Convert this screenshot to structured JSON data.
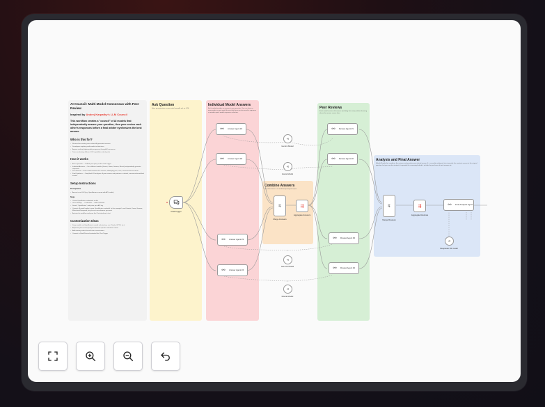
{
  "intro": {
    "title": "AI Council: Multi-Model Consensus with Peer Review",
    "inspired_prefix": "Inspired by ",
    "inspired_link": "Andrej Karpathy's LLM Council",
    "lead": "This workflow creates a \"council\" of AI models that independently answer your question, then peer-review each other's responses before a final arbiter synthesizes the best answer.",
    "who_heading": "Who is this for?",
    "who_items": [
      "Researchers wanting more robust AI-generated answers",
      "Developers exploring multi-model architectures",
      "Anyone seeking higher-quality responses through AI consensus",
      "Teams evaluating different LLM capabilities side-by-side"
    ],
    "how_heading": "How it works",
    "how_items": [
      "Ask a Question — Submit your query via the Chat Trigger",
      "Individual Answers — Four different models (Gemini, Llama, Gemma, Mistral) independently generate responses",
      "Peer Review — Each model reviews all 4 answers, identifying pros, cons, and overall assessment",
      "Final Synthesis — DeepSeek R1 analyzes all peer reviews and produces a refined, consensus-based final answer"
    ],
    "setup_heading": "Setup Instructions",
    "prereq_label": "Prerequisites",
    "prereq_items": [
      "Access to an LLM (e.g. OpenRouter account with API credits)"
    ],
    "steps_label": "Steps",
    "steps_items": [
      "Create OpenRouter credentials in n8n",
      "Go to Settings → Credentials → Add Credential",
      "Search \"OpenRouter\" and paste your API key",
      "Connect all model nodes to your OpenRouter credential. In this example I used Gemini, Llama, Gemma, Mistral and Deepseek, but you can use whatever you want.",
      "Activate the workflow and open the Chat interface to test"
    ],
    "custom_heading": "Customization Ideas",
    "custom_items": [
      "Swap models via OpenRouter's model selector (e.g. use Claude, GPT-4, etc.)",
      "Adjust the peer review prompt for domain-specific evaluation criteria",
      "Add memory nodes for multi-turn conversations",
      "Connect to Slack/Discord instead of the Chat Trigger"
    ]
  },
  "sections": {
    "ask": {
      "title": "Ask Question",
      "desc": "Enter your question as you would normally ask an LLM."
    },
    "individual": {
      "title": "Individual Model Answers",
      "desc": "Each model provides an answer to your question. You can have as many nodes as you want. As note that these are also used in sequence so avoid to quick model responses selection."
    },
    "combine": {
      "title": "Combine Answers",
      "desc": "Get all answers in a combined (anonymous) list."
    },
    "peer": {
      "title": "Peer Reviews",
      "desc": "Each model reviews all answers (including their own), without knowing where the answer comes from."
    },
    "analysis": {
      "title": "Analysis and Final Answer",
      "desc": "A final AI node that combines the reviews and provides your refined answer. It is currently configured to just provide the smartest answer to the original question, but you can also instruct it to provide the reasoning behind it, include the pros/cons of each answer etc."
    }
  },
  "nodes": {
    "chat_trigger": "Chat Trigger",
    "answer_agents": [
      "Answer Agent #1",
      "Answer Agent #2",
      "Answer Agent #3",
      "Answer Agent #4"
    ],
    "models_left": [
      "Gemini Model",
      "Llama Model",
      "Gemma Model",
      "Mistral Model"
    ],
    "merge_answers": "Merge Answers",
    "aggregate_answers": "Aggregate Answers",
    "review_agents": [
      "Review Agent #1",
      "Review Agent #2",
      "Review Agent #3",
      "Review Agent #4"
    ],
    "merge_reviews": "Merge Reviews",
    "aggregate_reviews": "Aggregate Reviews",
    "final_analysis": "Final Analysis Agent",
    "deepseek": "Deepseek R1 model"
  },
  "controls": {
    "fit": "fit-view-icon",
    "zoom_in": "zoom-in-icon",
    "zoom_out": "zoom-out-icon",
    "reset": "undo-icon"
  }
}
